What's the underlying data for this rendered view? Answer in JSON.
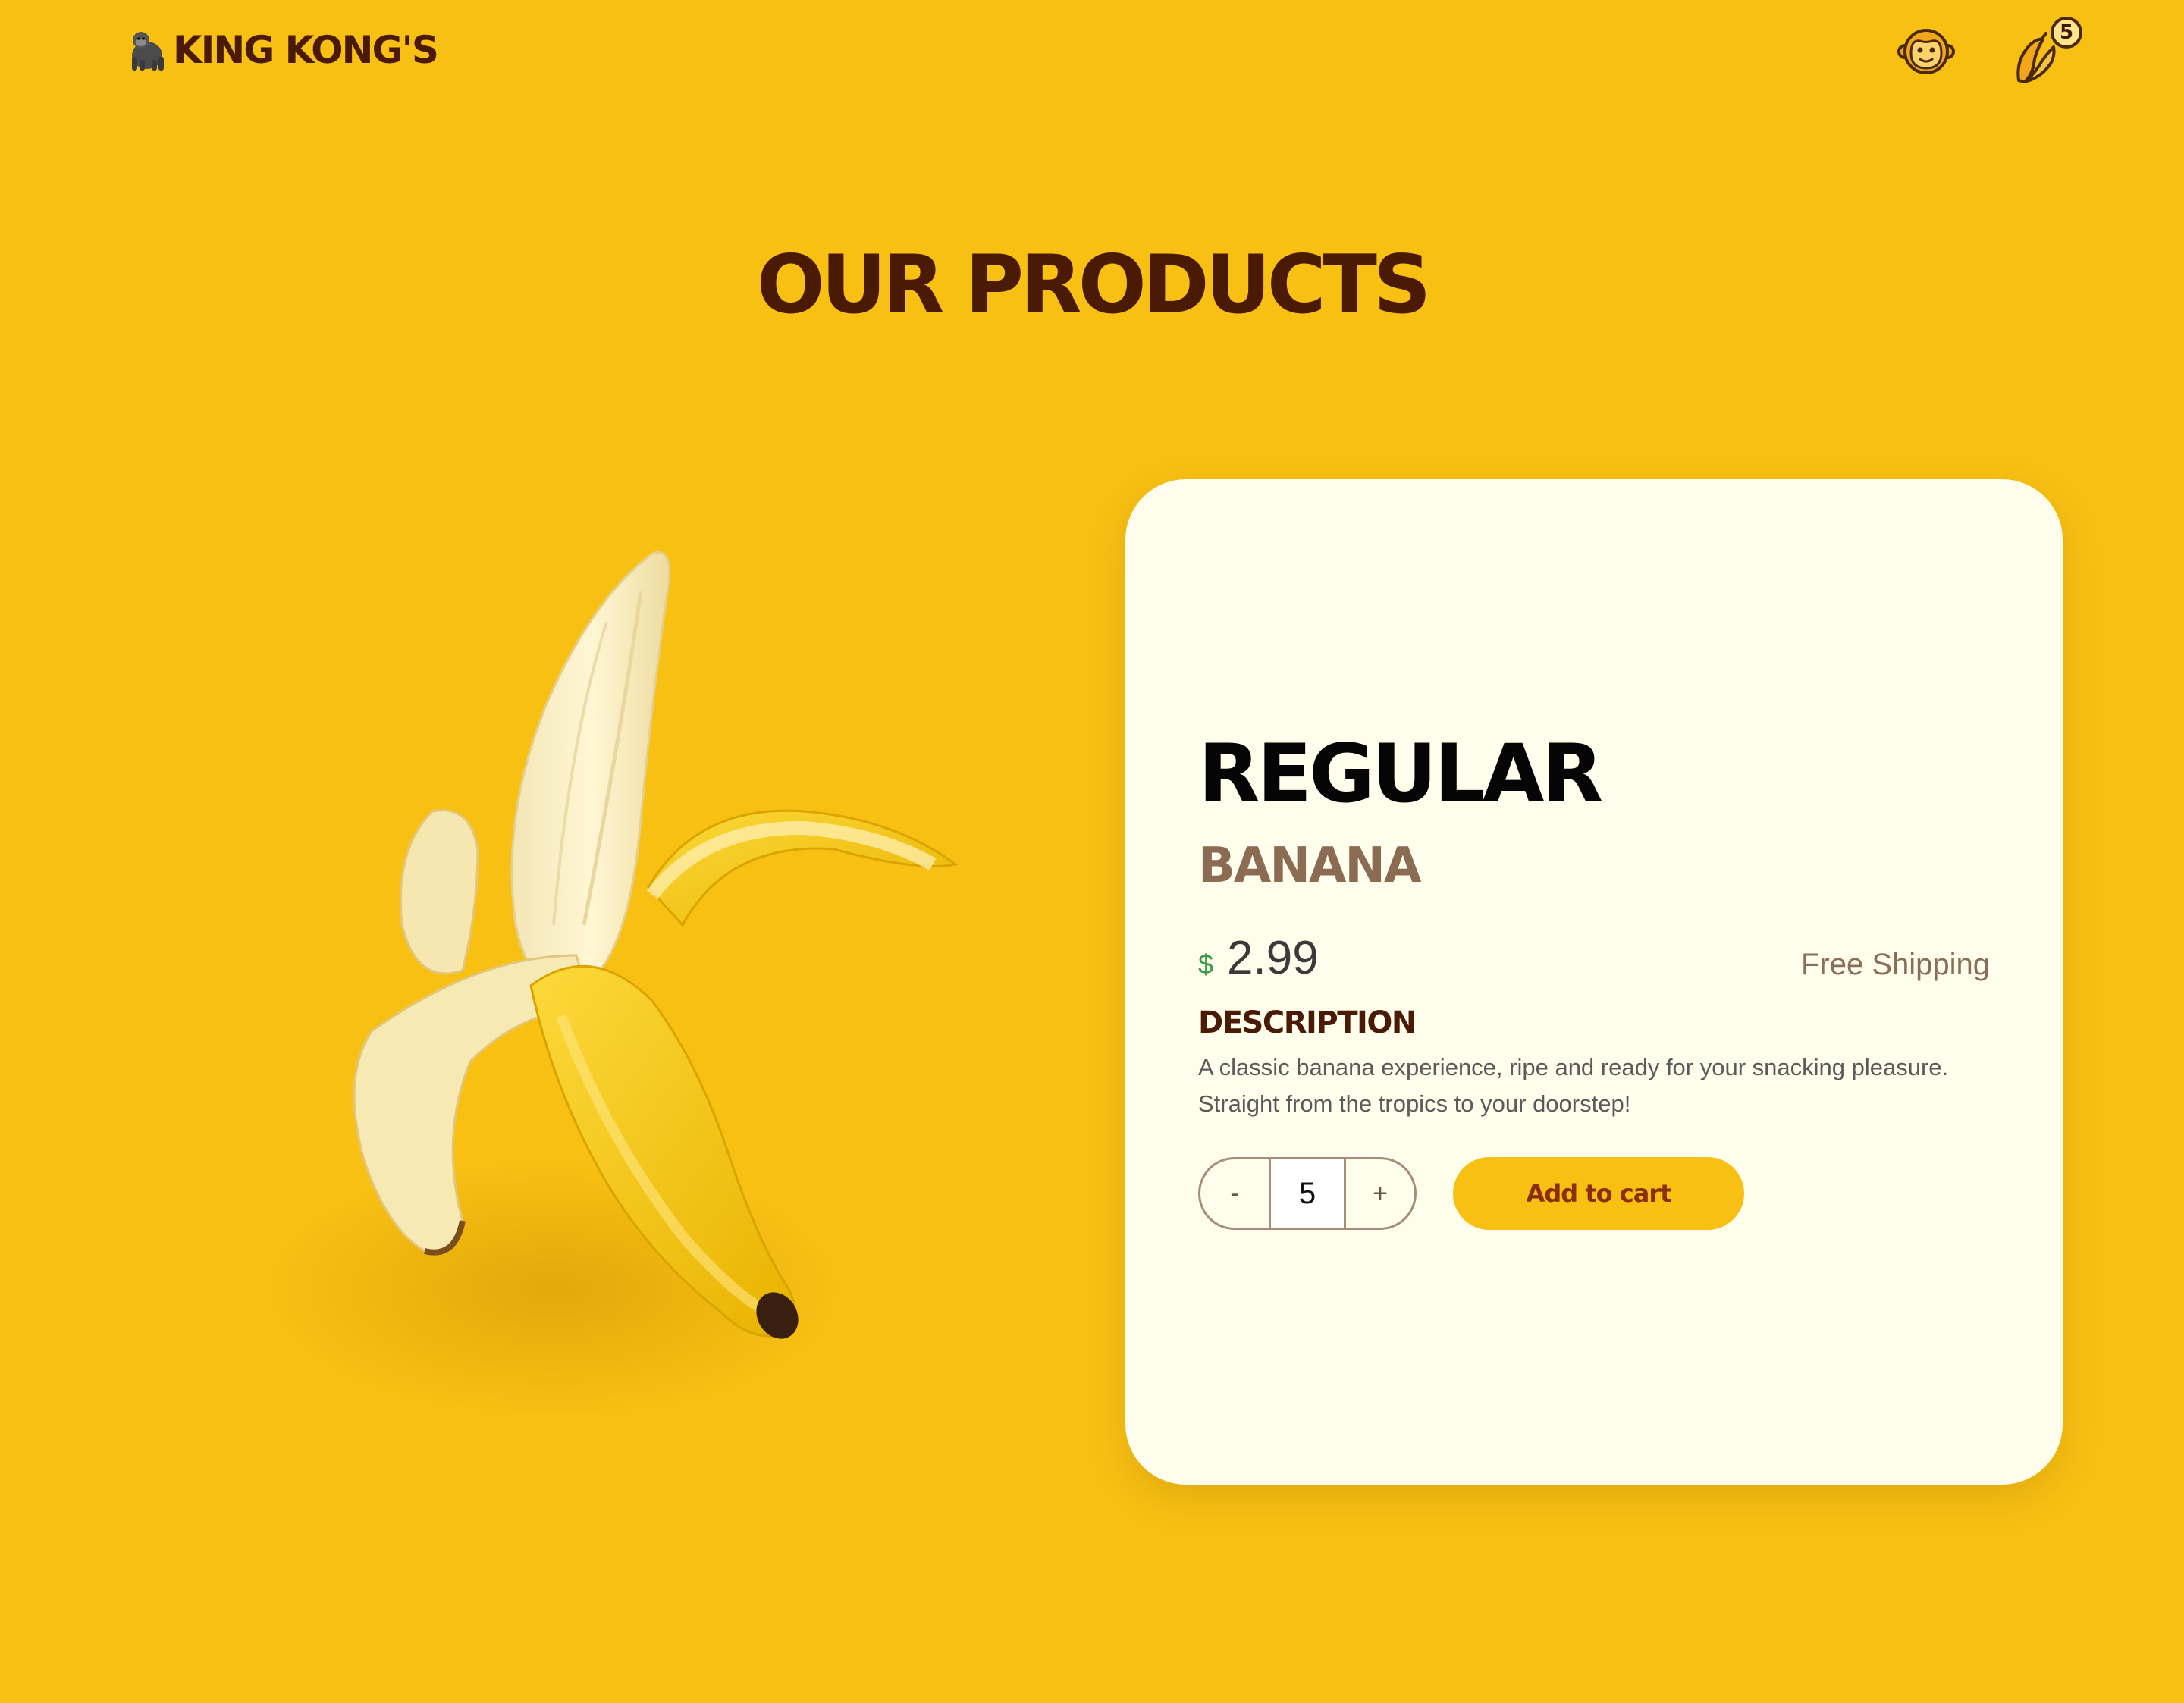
{
  "colors": {
    "background": "#F8C013",
    "brand_dark": "#4A1A05",
    "card": "#FFFEEC",
    "muted_brown": "#8B6B52",
    "currency_green": "#3E9A47",
    "button_text": "#8A2E0B"
  },
  "header": {
    "logo_icon": "gorilla-icon",
    "logo_text": "KING KONG'S",
    "account_icon": "monkey-face-icon",
    "cart_icon": "banana-cart-icon",
    "cart_count": "5"
  },
  "page": {
    "title": "OUR PRODUCTS"
  },
  "product": {
    "image_icon": "peeled-banana-image",
    "name": "REGULAR",
    "type": "BANANA",
    "currency": "$",
    "price": "2.99",
    "shipping": "Free Shipping",
    "description_heading": "DESCRIPTION",
    "description": "A classic banana experience, ripe and ready for your snacking pleasure. Straight from the tropics to your doorstep!",
    "quantity": "5",
    "decrement_label": "-",
    "increment_label": "+",
    "add_to_cart_label": "Add to cart"
  }
}
